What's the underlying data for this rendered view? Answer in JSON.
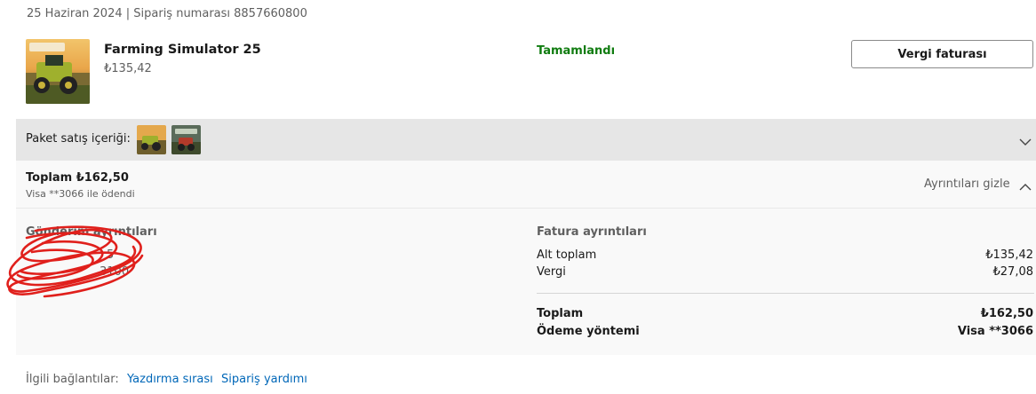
{
  "order": {
    "meta": "25 Haziran 2024 | Sipariş numarası 8857660800"
  },
  "item": {
    "title": "Farming Simulator 25",
    "price": "₺135,42",
    "status": "Tamamlandı",
    "tax_invoice_label": "Vergi faturası",
    "status_color": "#107c10"
  },
  "bundle": {
    "label": "Paket satış içeriği:",
    "icon": "chevron-down-icon"
  },
  "summary": {
    "total": "Toplam ₺162,50",
    "paid_with": "Visa **3066 ile ödendi",
    "hide_details": "Ayrıntıları gizle",
    "icon": "chevron-up-icon"
  },
  "shipping": {
    "title": "Gönderim ayrıntıları",
    "line1": "5",
    "line2": "3100",
    "line3": ""
  },
  "billing": {
    "title": "Fatura ayrıntıları",
    "rows": [
      {
        "label": "Alt toplam",
        "value": "₺135,42"
      },
      {
        "label": "Vergi",
        "value": "₺27,08"
      }
    ],
    "total_label": "Toplam",
    "total_value": "₺162,50",
    "payment_label": "Ödeme yöntemi",
    "payment_value": "Visa **3066"
  },
  "footer": {
    "label": "İlgili bağlantılar:",
    "links": [
      "Yazdırma sırası",
      "Sipariş yardımı"
    ],
    "link_color": "#0067b8"
  }
}
